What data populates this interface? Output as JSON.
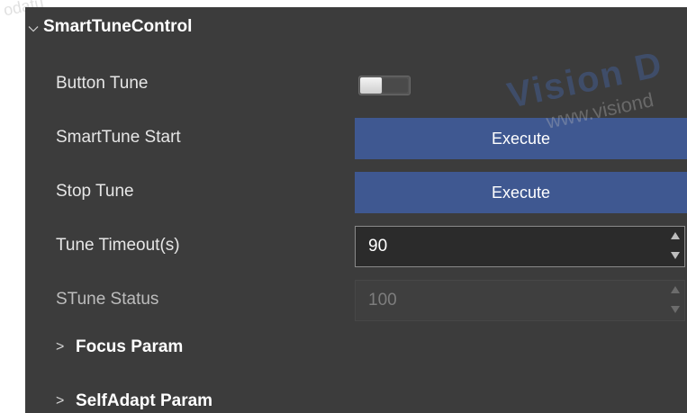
{
  "corner_watermark": "odatu",
  "section": {
    "title": "SmartTuneControl",
    "expanded": true
  },
  "rows": {
    "button_tune": {
      "label": "Button Tune",
      "value": "off"
    },
    "smarttune_start": {
      "label": "SmartTune Start",
      "button": "Execute"
    },
    "stop_tune": {
      "label": "Stop Tune",
      "button": "Execute"
    },
    "tune_timeout": {
      "label": "Tune Timeout(s)",
      "value": "90"
    },
    "stune_status": {
      "label": "STune Status",
      "value": "100"
    }
  },
  "groups": {
    "focus_param": "Focus Param",
    "selfadapt_param": "SelfAdapt Param"
  },
  "watermark": {
    "big": "Vision D",
    "small": "www.visiond"
  },
  "colors": {
    "panel_bg": "#3c3c3c",
    "execute_button": "#3f5891",
    "input_bg": "#2b2b2b"
  }
}
